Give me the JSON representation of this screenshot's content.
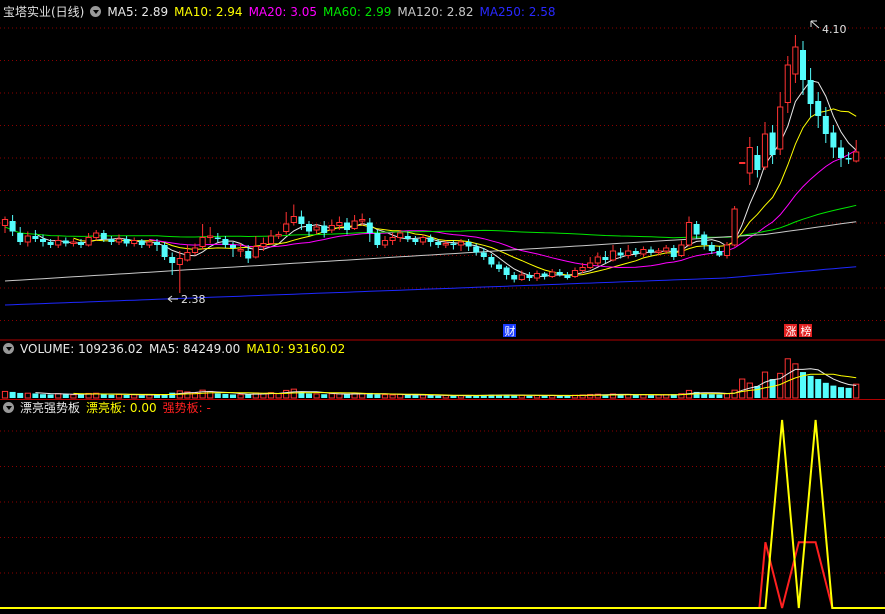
{
  "window": {
    "title": "宝塔实业(日线)"
  },
  "colors": {
    "up": "#ff3232",
    "down": "#54fcfc",
    "ma5": "#e8e8e8",
    "ma10": "#ffff00",
    "ma20": "#ff00ff",
    "ma60": "#00e600",
    "ma120": "#c8c8c8",
    "ma250": "#1e28ff",
    "grid": "#8b0000",
    "divider": "#b00000",
    "label_text": "#e0e0e0",
    "vol_ma5": "#e8e8e8",
    "vol_ma10": "#ffff00",
    "piao": "#ffff00",
    "qiang": "#ff2020",
    "badge_blue": "#1a3cff",
    "badge_red": "#e02020"
  },
  "icons": [
    "panel-collapse-icon"
  ],
  "main_panel": {
    "legend": [
      {
        "label": "MA5: 2.89",
        "color": "#e8e8e8"
      },
      {
        "label": "MA10: 2.94",
        "color": "#ffff00"
      },
      {
        "label": "MA20: 3.05",
        "color": "#ff00ff"
      },
      {
        "label": "MA60: 2.99",
        "color": "#00e600"
      },
      {
        "label": "MA120: 2.82",
        "color": "#c8c8c8"
      },
      {
        "label": "MA250: 2.58",
        "color": "#2828ff"
      }
    ],
    "high_label": "4.10",
    "low_label": "2.38",
    "badges": [
      {
        "text": "财",
        "color": "#1a3cff"
      },
      {
        "text": "涨",
        "color": "#e02020"
      },
      {
        "text": "榜",
        "color": "#e02020"
      }
    ]
  },
  "volume_panel": {
    "legend": [
      {
        "label": "VOLUME: 109236.02",
        "color": "#e8e8e8"
      },
      {
        "label": "MA5: 84249.00",
        "color": "#e8e8e8"
      },
      {
        "label": "MA10: 93160.02",
        "color": "#ffff00"
      }
    ]
  },
  "indicator_panel": {
    "legend": [
      {
        "label": "漂亮强势板",
        "color": "#e8e8e8"
      },
      {
        "label": "漂亮板: 0.00",
        "color": "#ffff00"
      },
      {
        "label": "强势板: -",
        "color": "#ff2020"
      }
    ]
  },
  "chart_data": [
    {
      "type": "candlestick",
      "title": "宝塔实业(日线)",
      "ylim": [
        2.2,
        4.2
      ],
      "candles": [
        [
          2.83,
          2.87,
          2.89,
          2.78
        ],
        [
          2.86,
          2.79,
          2.9,
          2.76
        ],
        [
          2.78,
          2.72,
          2.82,
          2.7
        ],
        [
          2.72,
          2.76,
          2.79,
          2.69
        ],
        [
          2.76,
          2.74,
          2.8,
          2.72
        ],
        [
          2.74,
          2.72,
          2.77,
          2.69
        ],
        [
          2.72,
          2.7,
          2.74,
          2.68
        ],
        [
          2.7,
          2.73,
          2.76,
          2.68
        ],
        [
          2.73,
          2.71,
          2.75,
          2.69
        ],
        [
          2.71,
          2.72,
          2.74,
          2.69
        ],
        [
          2.72,
          2.7,
          2.74,
          2.68
        ],
        [
          2.7,
          2.75,
          2.78,
          2.69
        ],
        [
          2.75,
          2.78,
          2.8,
          2.73
        ],
        [
          2.78,
          2.74,
          2.8,
          2.72
        ],
        [
          2.74,
          2.72,
          2.76,
          2.7
        ],
        [
          2.72,
          2.74,
          2.77,
          2.7
        ],
        [
          2.74,
          2.71,
          2.76,
          2.69
        ],
        [
          2.71,
          2.73,
          2.75,
          2.69
        ],
        [
          2.73,
          2.7,
          2.74,
          2.68
        ],
        [
          2.7,
          2.72,
          2.74,
          2.68
        ],
        [
          2.72,
          2.7,
          2.74,
          2.66
        ],
        [
          2.7,
          2.62,
          2.72,
          2.6
        ],
        [
          2.62,
          2.58,
          2.65,
          2.5
        ],
        [
          2.57,
          2.61,
          2.66,
          2.38
        ],
        [
          2.6,
          2.65,
          2.7,
          2.59
        ],
        [
          2.65,
          2.68,
          2.71,
          2.63
        ],
        [
          2.69,
          2.75,
          2.84,
          2.67
        ],
        [
          2.75,
          2.76,
          2.82,
          2.71
        ],
        [
          2.75,
          2.74,
          2.78,
          2.72
        ],
        [
          2.74,
          2.7,
          2.76,
          2.68
        ],
        [
          2.7,
          2.68,
          2.72,
          2.62
        ],
        [
          2.66,
          2.67,
          2.71,
          2.62
        ],
        [
          2.66,
          2.61,
          2.7,
          2.58
        ],
        [
          2.62,
          2.69,
          2.76,
          2.61
        ],
        [
          2.69,
          2.71,
          2.75,
          2.66
        ],
        [
          2.71,
          2.76,
          2.8,
          2.7
        ],
        [
          2.76,
          2.77,
          2.79,
          2.74
        ],
        [
          2.79,
          2.84,
          2.92,
          2.77
        ],
        [
          2.85,
          2.89,
          2.97,
          2.83
        ],
        [
          2.89,
          2.84,
          2.93,
          2.8
        ],
        [
          2.84,
          2.79,
          2.86,
          2.76
        ],
        [
          2.8,
          2.82,
          2.84,
          2.77
        ],
        [
          2.83,
          2.78,
          2.86,
          2.75
        ],
        [
          2.8,
          2.83,
          2.87,
          2.78
        ],
        [
          2.83,
          2.85,
          2.89,
          2.8
        ],
        [
          2.85,
          2.8,
          2.88,
          2.77
        ],
        [
          2.81,
          2.86,
          2.9,
          2.8
        ],
        [
          2.86,
          2.87,
          2.91,
          2.83
        ],
        [
          2.85,
          2.78,
          2.88,
          2.72
        ],
        [
          2.78,
          2.7,
          2.8,
          2.68
        ],
        [
          2.7,
          2.73,
          2.76,
          2.68
        ],
        [
          2.73,
          2.75,
          2.78,
          2.7
        ],
        [
          2.75,
          2.78,
          2.8,
          2.72
        ],
        [
          2.76,
          2.74,
          2.79,
          2.72
        ],
        [
          2.74,
          2.72,
          2.76,
          2.7
        ],
        [
          2.72,
          2.75,
          2.77,
          2.7
        ],
        [
          2.75,
          2.72,
          2.77,
          2.69
        ],
        [
          2.72,
          2.7,
          2.74,
          2.68
        ],
        [
          2.7,
          2.71,
          2.73,
          2.68
        ],
        [
          2.71,
          2.7,
          2.73,
          2.67
        ],
        [
          2.7,
          2.72,
          2.74,
          2.66
        ],
        [
          2.72,
          2.69,
          2.74,
          2.66
        ],
        [
          2.69,
          2.65,
          2.71,
          2.63
        ],
        [
          2.65,
          2.62,
          2.68,
          2.6
        ],
        [
          2.62,
          2.57,
          2.64,
          2.55
        ],
        [
          2.57,
          2.54,
          2.59,
          2.52
        ],
        [
          2.55,
          2.5,
          2.56,
          2.47
        ],
        [
          2.5,
          2.47,
          2.52,
          2.45
        ],
        [
          2.47,
          2.5,
          2.53,
          2.46
        ],
        [
          2.5,
          2.48,
          2.52,
          2.46
        ],
        [
          2.48,
          2.51,
          2.53,
          2.46
        ],
        [
          2.51,
          2.49,
          2.52,
          2.47
        ],
        [
          2.49,
          2.52,
          2.54,
          2.48
        ],
        [
          2.52,
          2.5,
          2.54,
          2.49
        ],
        [
          2.5,
          2.48,
          2.52,
          2.47
        ],
        [
          2.49,
          2.53,
          2.55,
          2.48
        ],
        [
          2.53,
          2.55,
          2.58,
          2.51
        ],
        [
          2.55,
          2.58,
          2.62,
          2.54
        ],
        [
          2.58,
          2.62,
          2.65,
          2.56
        ],
        [
          2.62,
          2.6,
          2.66,
          2.58
        ],
        [
          2.6,
          2.66,
          2.7,
          2.59
        ],
        [
          2.65,
          2.63,
          2.68,
          2.61
        ],
        [
          2.63,
          2.66,
          2.7,
          2.61
        ],
        [
          2.66,
          2.64,
          2.68,
          2.62
        ],
        [
          2.64,
          2.67,
          2.69,
          2.62
        ],
        [
          2.67,
          2.65,
          2.69,
          2.63
        ],
        [
          2.65,
          2.66,
          2.68,
          2.63
        ],
        [
          2.66,
          2.68,
          2.7,
          2.64
        ],
        [
          2.68,
          2.62,
          2.7,
          2.6
        ],
        [
          2.63,
          2.7,
          2.73,
          2.62
        ],
        [
          2.7,
          2.85,
          2.89,
          2.69
        ],
        [
          2.84,
          2.77,
          2.86,
          2.74
        ],
        [
          2.77,
          2.7,
          2.79,
          2.67
        ],
        [
          2.7,
          2.66,
          2.72,
          2.64
        ],
        [
          2.66,
          2.63,
          2.69,
          2.62
        ],
        [
          2.63,
          2.7,
          2.72,
          2.61
        ],
        [
          2.7,
          2.94,
          2.96,
          2.69
        ],
        [
          3.25,
          3.25,
          3.25,
          3.25
        ],
        [
          3.18,
          3.35,
          3.42,
          3.1
        ],
        [
          3.3,
          3.2,
          3.36,
          3.15
        ],
        [
          3.22,
          3.44,
          3.52,
          3.2
        ],
        [
          3.45,
          3.3,
          3.5,
          3.24
        ],
        [
          3.34,
          3.62,
          3.72,
          3.3
        ],
        [
          3.65,
          3.9,
          3.96,
          3.58
        ],
        [
          3.84,
          4.02,
          4.1,
          3.78
        ],
        [
          4.0,
          3.8,
          4.06,
          3.7
        ],
        [
          3.8,
          3.64,
          3.88,
          3.55
        ],
        [
          3.66,
          3.56,
          3.72,
          3.48
        ],
        [
          3.56,
          3.44,
          3.62,
          3.38
        ],
        [
          3.45,
          3.35,
          3.5,
          3.28
        ],
        [
          3.35,
          3.28,
          3.4,
          3.22
        ],
        [
          3.28,
          3.27,
          3.32,
          3.24
        ],
        [
          3.26,
          3.32,
          3.4,
          3.25
        ]
      ],
      "moving_averages": [
        {
          "name": "MA5",
          "last": 2.89
        },
        {
          "name": "MA10",
          "last": 2.94
        },
        {
          "name": "MA20",
          "last": 3.05
        },
        {
          "name": "MA60",
          "last": 2.99
        },
        {
          "name": "MA120",
          "last": 2.82
        },
        {
          "name": "MA250",
          "last": 2.58
        }
      ],
      "high": 4.1,
      "low": 2.38
    },
    {
      "type": "bar",
      "title": "VOLUME",
      "values": [
        52000,
        48000,
        40000,
        38000,
        36000,
        30000,
        28000,
        34000,
        30000,
        26000,
        28000,
        36000,
        38000,
        30000,
        26000,
        28000,
        24000,
        26000,
        22000,
        24000,
        26000,
        30000,
        42000,
        56000,
        48000,
        40000,
        62000,
        52000,
        36000,
        32000,
        28000,
        26000,
        30000,
        40000,
        36000,
        42000,
        34000,
        60000,
        70000,
        48000,
        36000,
        32000,
        30000,
        34000,
        32000,
        28000,
        36000,
        34000,
        40000,
        30000,
        26000,
        24000,
        28000,
        24000,
        22000,
        24000,
        20000,
        18000,
        20000,
        18000,
        20000,
        18000,
        22000,
        24000,
        26000,
        24000,
        22000,
        20000,
        22000,
        18000,
        20000,
        18000,
        20000,
        18000,
        20000,
        22000,
        24000,
        28000,
        30000,
        26000,
        32000,
        26000,
        28000,
        24000,
        26000,
        22000,
        24000,
        26000,
        30000,
        34000,
        60000,
        48000,
        36000,
        30000,
        28000,
        34000,
        62000,
        150000,
        118000,
        95000,
        205000,
        150000,
        195000,
        310000,
        270000,
        205000,
        175000,
        150000,
        120000,
        98000,
        86000,
        80000,
        109236
      ],
      "ma5_last": 84249.0,
      "ma10_last": 93160.02,
      "ylim": [
        0,
        340000
      ]
    },
    {
      "type": "line",
      "title": "漂亮强势板",
      "series": [
        {
          "name": "漂亮板",
          "values": [
            0,
            1,
            0,
            1,
            0
          ],
          "last": 0.0
        },
        {
          "name": "强势板",
          "values": [
            0.35,
            0,
            0.35,
            0.35,
            0
          ]
        }
      ],
      "ylim": [
        0,
        1
      ]
    }
  ]
}
